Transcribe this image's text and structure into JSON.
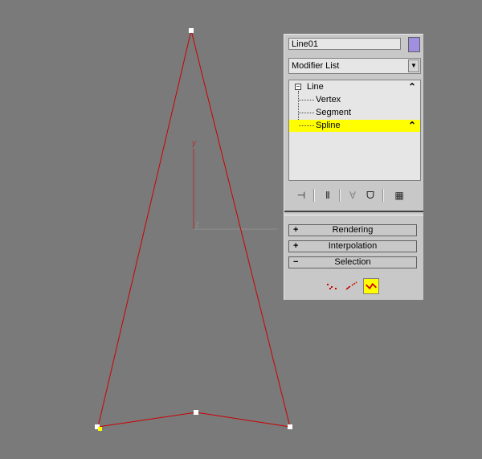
{
  "object": {
    "name": "Line01",
    "color": "#a08ee0"
  },
  "modifier_list": {
    "value": "Modifier List"
  },
  "stack": {
    "items": [
      {
        "label": "Line",
        "level": "object"
      },
      {
        "label": "Vertex",
        "level": "sub"
      },
      {
        "label": "Segment",
        "level": "sub"
      },
      {
        "label": "Spline",
        "level": "sub",
        "selected": true
      }
    ]
  },
  "toolbar": {
    "icons": [
      "pin-stack-icon",
      "show-end-result-icon",
      "make-unique-icon",
      "remove-modifier-icon",
      "configure-modifier-sets-icon"
    ]
  },
  "rollouts": [
    {
      "label": "Rendering",
      "state": "+"
    },
    {
      "label": "Interpolation",
      "state": "+"
    },
    {
      "label": "Selection",
      "state": "−"
    }
  ],
  "selection_levels": {
    "active": "spline"
  },
  "viewport": {
    "gizmo_y_label": "y",
    "gizmo_x_label": "z",
    "spline_color": "#cc0000",
    "selection_color": "#ffff00"
  }
}
